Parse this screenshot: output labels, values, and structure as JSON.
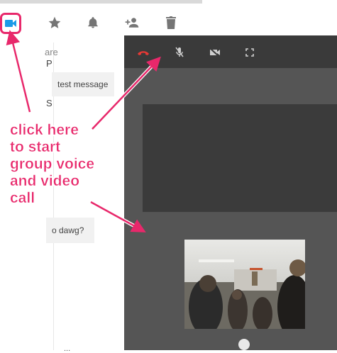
{
  "toolbar": {
    "icons": [
      "video-camera-icon",
      "star-icon",
      "bell-icon",
      "add-person-icon",
      "trash-icon"
    ]
  },
  "chat": {
    "frag_top": "are",
    "frag_p": "P",
    "frag_s": "S",
    "bubble1": "test message",
    "bubble2": "o dawg?",
    "bottom_text": "..."
  },
  "call_controls": {
    "icons": [
      "end-call-icon",
      "mute-mic-icon",
      "video-off-icon",
      "fullscreen-icon"
    ]
  },
  "annotation": {
    "text": "click here\nto start\ngroup voice\nand video\ncall"
  },
  "colors": {
    "accent": "#e8286b",
    "video_blue": "#1a9be8",
    "end_call_red": "#e53935",
    "panel_bg": "#555555",
    "panel_top": "#3a3a3a"
  }
}
